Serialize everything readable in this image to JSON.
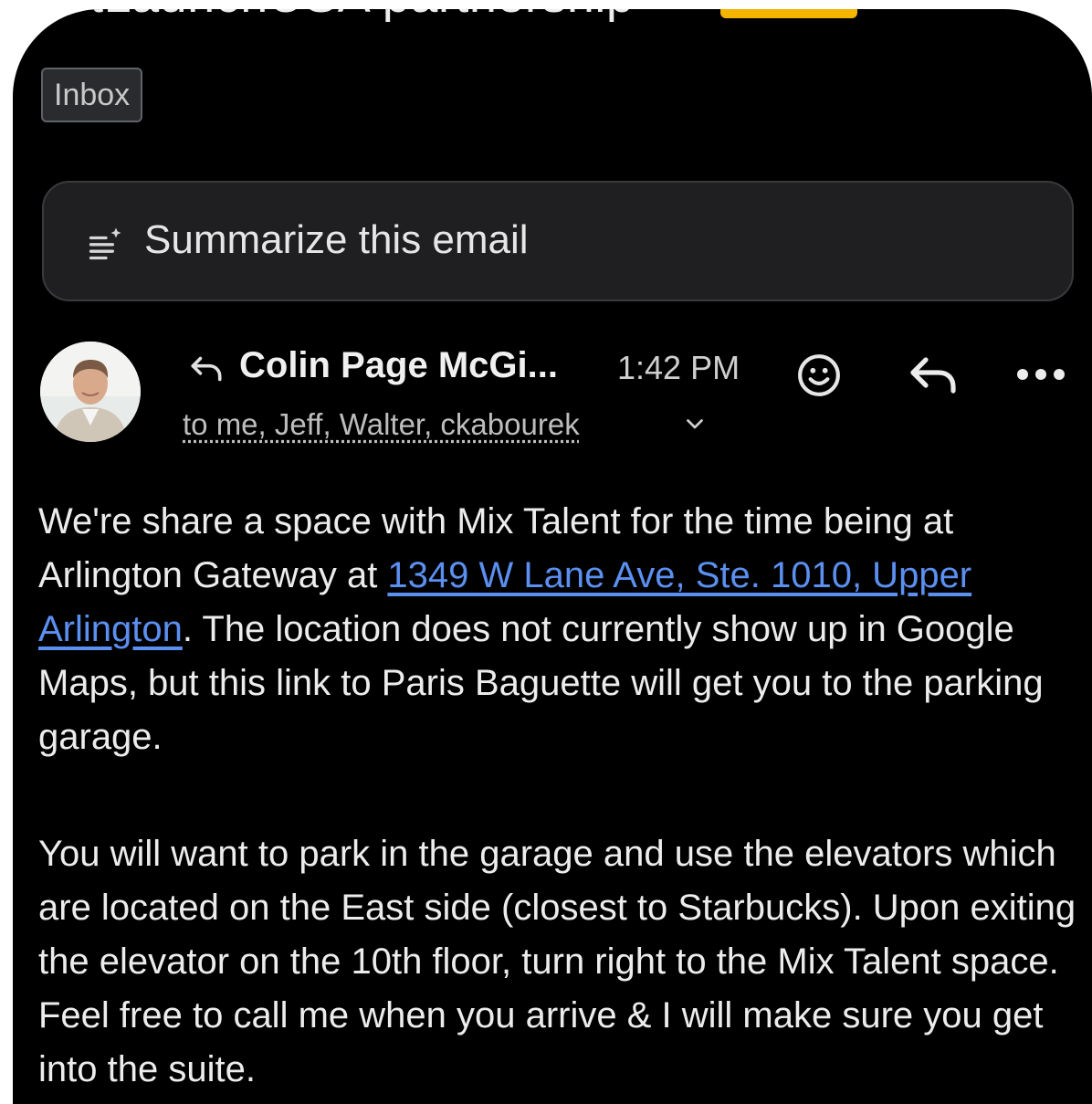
{
  "email": {
    "subject": "VetLaunchUSA partnership",
    "external_badge": "External",
    "label_chip": "Inbox"
  },
  "summarize": {
    "label": "Summarize this email",
    "icon": "summarize-sparkle-icon"
  },
  "message": {
    "sender": "Colin Page McGi...",
    "time": "1:42 PM",
    "recipients": "to me, Jeff, Walter, ckabourek",
    "body": {
      "p1_before": "We're share a space with Mix Talent for the time being at Arlington Gateway at ",
      "p1_link": "1349 W Lane Ave, Ste. 1010, Upper Arlington",
      "p1_after": ". The location does not currently show up in Google Maps, but this link to Paris Baguette will get you to the parking garage.",
      "p2": "You will want to park in the garage and use the elevators which are located on the East side (closest to Starbucks). Upon exiting the elevator on the 10th floor, turn right to the Mix Talent space. Feel free to call me when you arrive & I will make sure you get into the suite."
    }
  },
  "icons": {
    "star": "star-outline-icon",
    "reply_small": "reply-arrow-icon",
    "emoji": "emoji-smile-icon",
    "reply": "reply-icon",
    "more": "more-horizontal-icon",
    "chevron": "chevron-down-icon"
  },
  "colors": {
    "background": "#000000",
    "external_badge": "#f4b400",
    "link": "#5b8ff0",
    "summarize_bg": "#1f1f21"
  }
}
